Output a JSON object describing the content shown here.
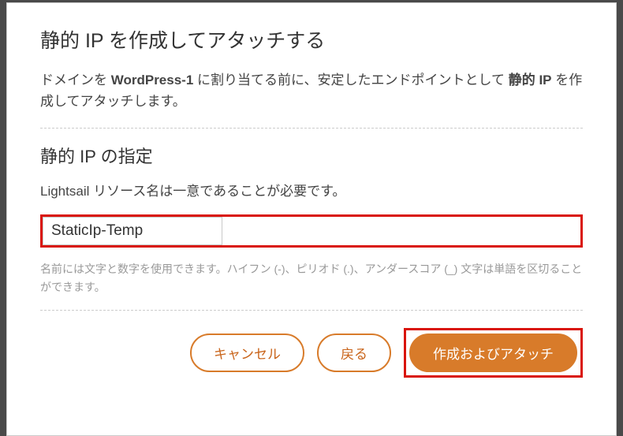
{
  "modal": {
    "title": "静的 IP を作成してアタッチする",
    "description_prefix": "ドメインを ",
    "description_bold": "WordPress-1",
    "description_mid": " に割り当てる前に、安定したエンドポイントとして ",
    "description_bold2": "静的 IP",
    "description_suffix": " を作成してアタッチします。",
    "section_title": "静的 IP の指定",
    "field_label": "Lightsail リソース名は一意であることが必要です。",
    "input_value": "StaticIp-Temp",
    "hint": "名前には文字と数字を使用できます。ハイフン (-)、ピリオド (.)、アンダースコア (_) 文字は単語を区切ることができます。",
    "buttons": {
      "cancel": "キャンセル",
      "back": "戻る",
      "create": "作成およびアタッチ"
    }
  }
}
